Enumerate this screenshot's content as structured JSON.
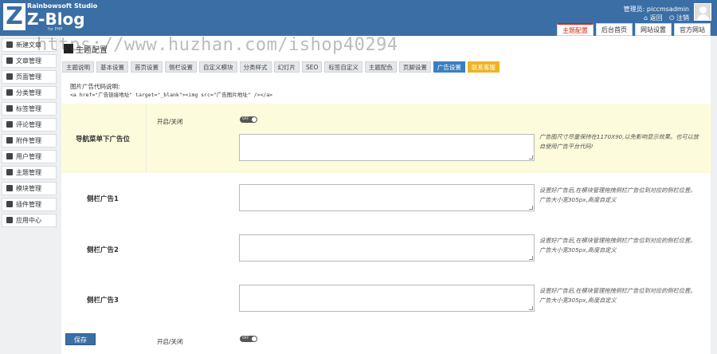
{
  "header": {
    "brand_studio": "Rainbowsoft Studio",
    "brand_name": "Z-Blog",
    "brand_logo_letter": "Z",
    "brand_sub": "for PHP",
    "admin_line": "管理员: piccmsadmin",
    "back_link": "⌂ 返回",
    "logout_link": "⏻ 注销",
    "tabs": [
      {
        "label": "主题配置",
        "active": true
      },
      {
        "label": "后台首页",
        "active": false
      },
      {
        "label": "网站设置",
        "active": false
      },
      {
        "label": "官方网站",
        "active": false
      }
    ],
    "colors": {
      "bar": "#3a6ea5",
      "active_tab_text": "#d9230f"
    }
  },
  "sidebar": {
    "items": [
      {
        "label": "新建文章",
        "icon": "pencil-icon"
      },
      {
        "label": "文章管理",
        "icon": "document-icon"
      },
      {
        "label": "页面管理",
        "icon": "page-icon"
      },
      {
        "label": "分类管理",
        "icon": "folder-icon"
      },
      {
        "label": "标签管理",
        "icon": "tag-icon"
      },
      {
        "label": "评论管理",
        "icon": "comment-icon"
      },
      {
        "label": "附件管理",
        "icon": "attachment-icon"
      },
      {
        "label": "用户管理",
        "icon": "user-icon"
      },
      {
        "label": "主题管理",
        "icon": "theme-icon"
      },
      {
        "label": "模块管理",
        "icon": "module-icon"
      },
      {
        "label": "插件管理",
        "icon": "plugin-icon"
      },
      {
        "label": "应用中心",
        "icon": "app-center-icon"
      }
    ]
  },
  "watermark": "https://www.huzhan.com/ishop40294",
  "main": {
    "page_title": "主题配置",
    "subtabs": [
      {
        "label": "主题说明",
        "style": "normal"
      },
      {
        "label": "基本设置",
        "style": "normal"
      },
      {
        "label": "首页设置",
        "style": "normal"
      },
      {
        "label": "侧栏设置",
        "style": "normal"
      },
      {
        "label": "自定义模块",
        "style": "normal"
      },
      {
        "label": "分类样式",
        "style": "normal"
      },
      {
        "label": "幻灯片",
        "style": "normal"
      },
      {
        "label": "SEO",
        "style": "normal"
      },
      {
        "label": "标签自定义",
        "style": "normal"
      },
      {
        "label": "主题配色",
        "style": "normal"
      },
      {
        "label": "页脚设置",
        "style": "normal"
      },
      {
        "label": "广告设置",
        "style": "active"
      },
      {
        "label": "联系客服",
        "style": "orange"
      }
    ],
    "code_label": "图片广告代码说明:",
    "code_sample": "<a href=\"广告链接地址\" target=\"_blank\"><img src=\"广告图片地址\" /></a>",
    "rows": [
      {
        "label": "导航菜单下广告位",
        "toggle_label": "开启/关闭",
        "toggle_state": "OFF",
        "textarea_value": "",
        "hint": "广告图尺寸尽量保持在1170X90,以免影响显示效果。也可以放自使用广告平台代码!"
      },
      {
        "label": "侧栏广告1",
        "textarea_value": "",
        "hint": "设置好广告后,在模块管理拖拽侧栏广告位到对应的侧栏位置。广告大小宽305px,高度自定义"
      },
      {
        "label": "侧栏广告2",
        "textarea_value": "",
        "hint": "设置好广告后,在模块管理拖拽侧栏广告位到对应的侧栏位置。广告大小宽305px,高度自定义"
      },
      {
        "label": "侧栏广告3",
        "textarea_value": "",
        "hint": "设置好广告后,在模块管理拖拽侧栏广告位到对应的侧栏位置。广告大小宽305px,高度自定义"
      }
    ],
    "bottom_toggle_label": "开启/关闭",
    "bottom_toggle_state": "OFF",
    "save_label": "保存"
  }
}
